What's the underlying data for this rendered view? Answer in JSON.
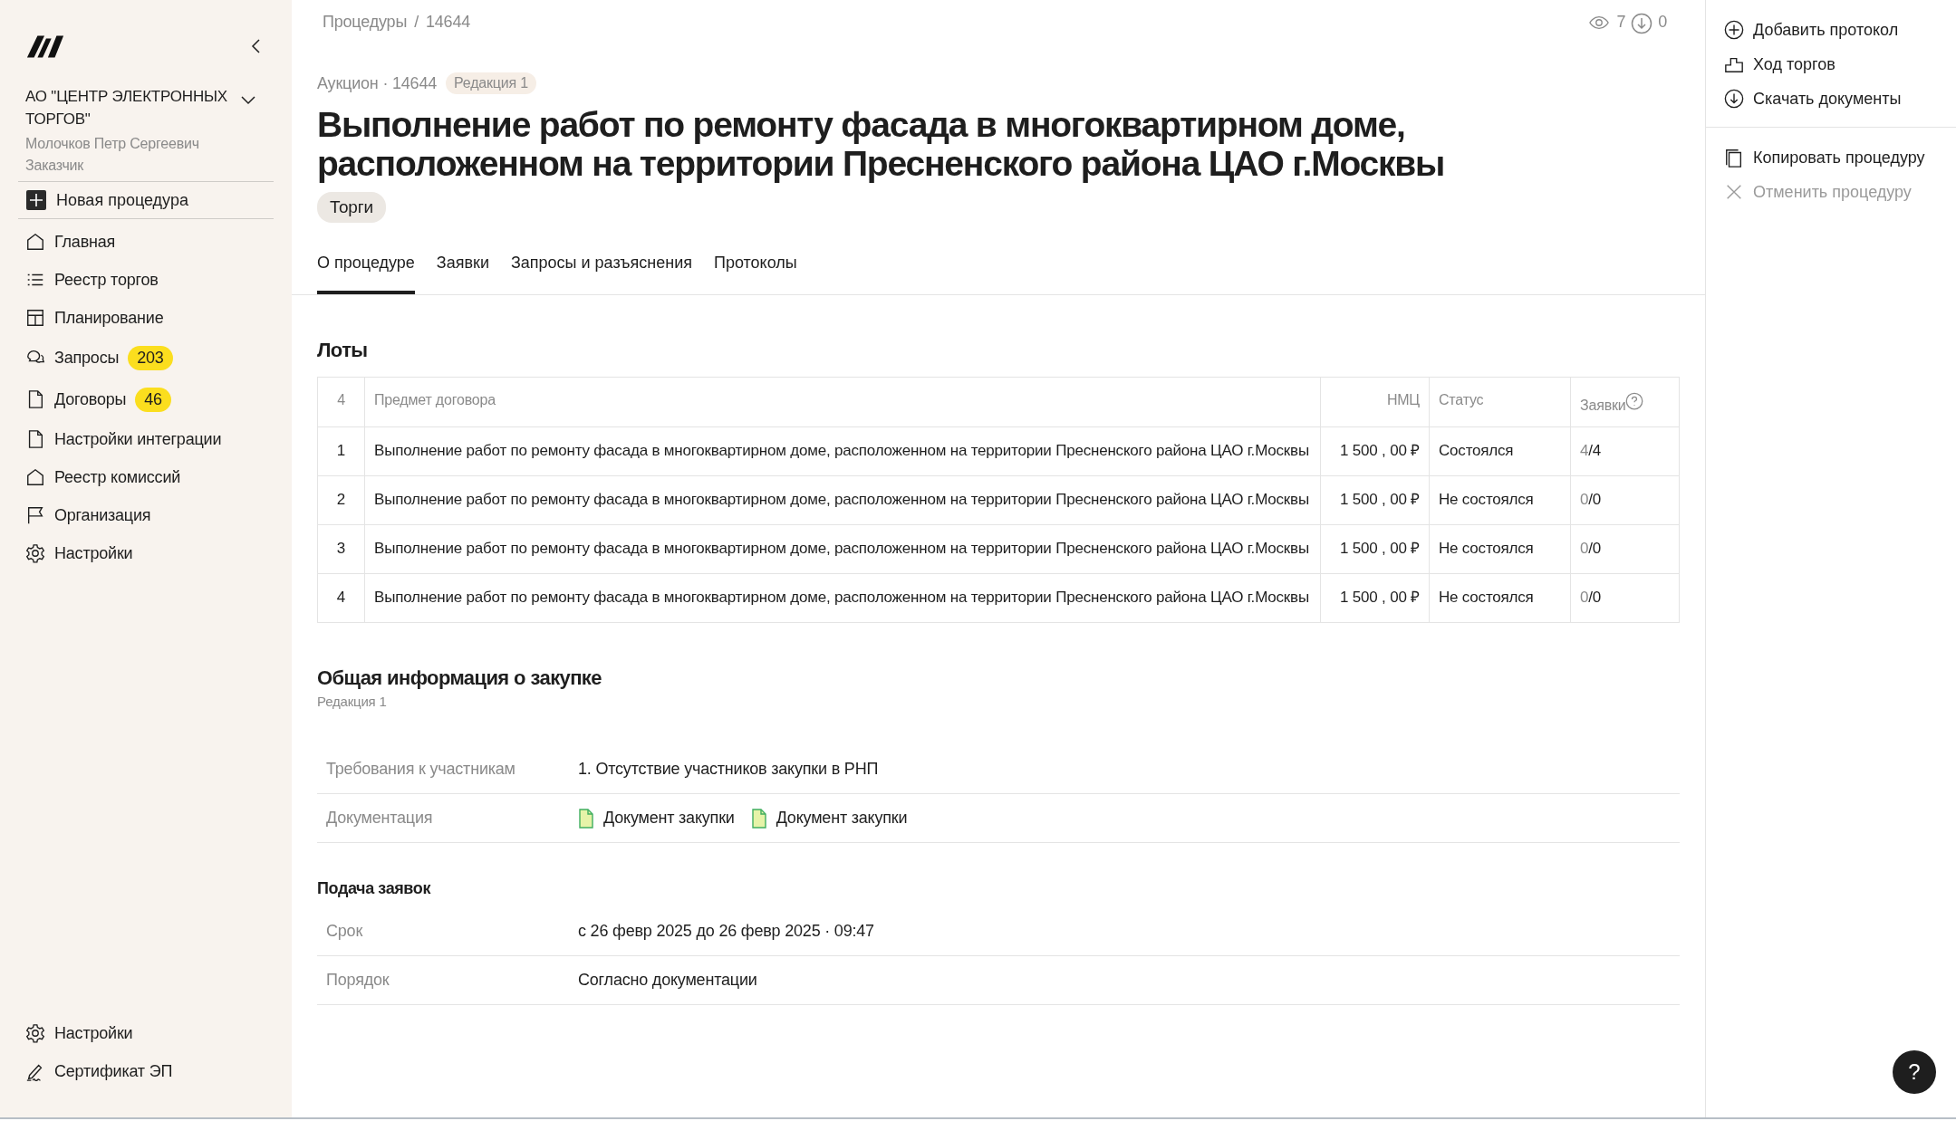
{
  "sidebar": {
    "org": {
      "name": "АО \"ЦЕНТР ЭЛЕКТРОННЫХ ТОРГОВ\"",
      "user": "Молочков Петр Сергеевич",
      "role": "Заказчик"
    },
    "new_button": "Новая процедура",
    "items": [
      {
        "label": "Главная"
      },
      {
        "label": "Реестр торгов"
      },
      {
        "label": "Планирование"
      },
      {
        "label": "Запросы",
        "badge": "203"
      },
      {
        "label": "Договоры",
        "badge": "46"
      },
      {
        "label": "Настройки интеграции"
      },
      {
        "label": "Реестр комиссий"
      },
      {
        "label": "Организация"
      },
      {
        "label": "Настройки"
      }
    ],
    "bottom_items": [
      {
        "label": "Настройки"
      },
      {
        "label": "Сертификат ЭП"
      }
    ]
  },
  "breadcrumbs": [
    "Процедуры",
    "/",
    "14644"
  ],
  "stats": {
    "views": "7",
    "downloads": "0"
  },
  "procedure": {
    "meta": "Аукцион · 14644",
    "revision": "Редакция 1",
    "title": "Выполнение работ по ремонту фасада в многоквартирном доме, расположенном на территории Пресненского района ЦАО г.Москвы",
    "tag": "Торги"
  },
  "tabs": [
    {
      "label": "О процедуре",
      "selected": true
    },
    {
      "label": "Заявки",
      "selected": false
    },
    {
      "label": "Запросы и разъяснения",
      "selected": false
    },
    {
      "label": "Протоколы",
      "selected": false
    }
  ],
  "lots": {
    "title": "Лоты",
    "columns": [
      "4",
      "Предмет договора",
      "НМЦ",
      "Статус",
      "Заявки"
    ],
    "rows": [
      {
        "number": "1",
        "subject": "Выполнение работ по ремонту фасада в многоквартирном доме, расположенном на территории Пресненского района ЦАО г.Москвы",
        "price": "1 500 , 00 ₽",
        "status": "Состоялся",
        "accepted": "4",
        "total": "/4"
      },
      {
        "number": "2",
        "subject": "Выполнение работ по ремонту фасада в многоквартирном доме, расположенном на территории Пресненского района ЦАО г.Москвы",
        "price": "1 500 , 00 ₽",
        "status": "Не состоялся",
        "accepted": "0",
        "total": "/0"
      },
      {
        "number": "3",
        "subject": "Выполнение работ по ремонту фасада в многоквартирном доме, расположенном на территории Пресненского района ЦАО г.Москвы",
        "price": "1 500 , 00 ₽",
        "status": "Не состоялся",
        "accepted": "0",
        "total": "/0"
      },
      {
        "number": "4",
        "subject": "Выполнение работ по ремонту фасада в многоквартирном доме, расположенном на территории Пресненского района ЦАО г.Москвы",
        "price": "1 500 , 00 ₽",
        "status": "Не состоялся",
        "accepted": "0",
        "total": "/0"
      }
    ]
  },
  "general": {
    "title": "Общая информация о закупке",
    "subtitle": "Редакция 1",
    "rows": [
      {
        "label": "Требования к участникам",
        "kind": "text",
        "value": "1. Отсутствие участников закупки в РНП"
      },
      {
        "label": "Документация",
        "kind": "files",
        "files": [
          "Документ закупки",
          "Документ закупки"
        ]
      }
    ]
  },
  "submission": {
    "title": "Подача заявок",
    "rows": [
      {
        "label": "Срок",
        "value": "с 26 февр 2025 до 26 февр 2025 · 09:47"
      },
      {
        "label": "Порядок",
        "value": "Согласно документации"
      }
    ]
  },
  "actions": [
    {
      "label": "Добавить протокол",
      "disabled": false
    },
    {
      "label": "Ход торгов",
      "disabled": false
    },
    {
      "label": "Скачать документы",
      "disabled": false
    }
  ],
  "actions_secondary": [
    {
      "label": "Копировать процедуру",
      "disabled": false
    },
    {
      "label": "Отменить процедуру",
      "disabled": true
    }
  ],
  "help_button": "?"
}
